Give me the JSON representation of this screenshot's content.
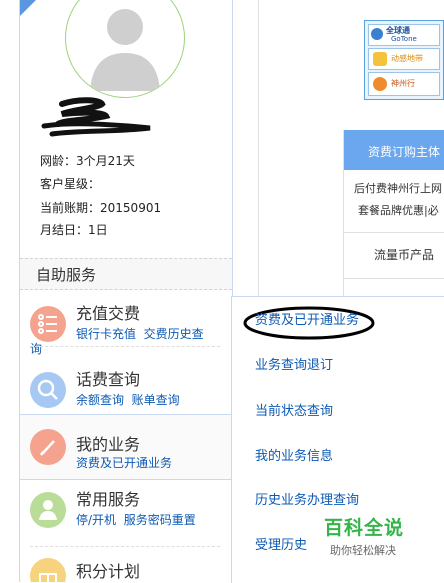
{
  "profile": {
    "name_label": "网龄：",
    "age_value": "3个月21天",
    "star_label": "客户星级：",
    "billing_label": "当前账期：",
    "billing_value": "20150901",
    "settle_label": "月结日：",
    "settle_value": "1日"
  },
  "sidebar": {
    "section_title": "自助服务",
    "items": [
      {
        "title": "充值交费",
        "sub1": "银行卡充值",
        "sub2": "交费历史查",
        "sub3": "询",
        "icon": "list-icon",
        "color": "#f5a28e"
      },
      {
        "title": "话费查询",
        "sub1": "余额查询",
        "sub2": "账单查询",
        "icon": "magnifier-icon",
        "color": "#a7c8f2"
      },
      {
        "title": "我的业务",
        "sub1": "资费及已开通业务",
        "icon": "pencil-icon",
        "color": "#f5a28e"
      },
      {
        "title": "常用服务",
        "sub1": "停/开机",
        "sub2": "服务密码重置",
        "icon": "person-icon",
        "color": "#b9dc98"
      },
      {
        "title": "积分计划",
        "icon": "gift-icon",
        "color": "#f6d37c"
      }
    ]
  },
  "submenu": {
    "items": [
      "资费及已开通业务",
      "业务查询退订",
      "当前状态查询",
      "我的业务信息",
      "历史业务办理查询",
      "受理历史"
    ]
  },
  "table": {
    "header": "资费订购主体",
    "row1_line1": "后付费神州行上网",
    "row1_line2": "套餐品牌优惠|必",
    "row2": "流量币产品"
  },
  "ad": {
    "brand": "全球通",
    "brand_en": "GoTone",
    "label2": "动感地带",
    "label3": "神州行"
  },
  "watermark": {
    "title": "百科全说",
    "subtitle": "助你轻松解决"
  }
}
